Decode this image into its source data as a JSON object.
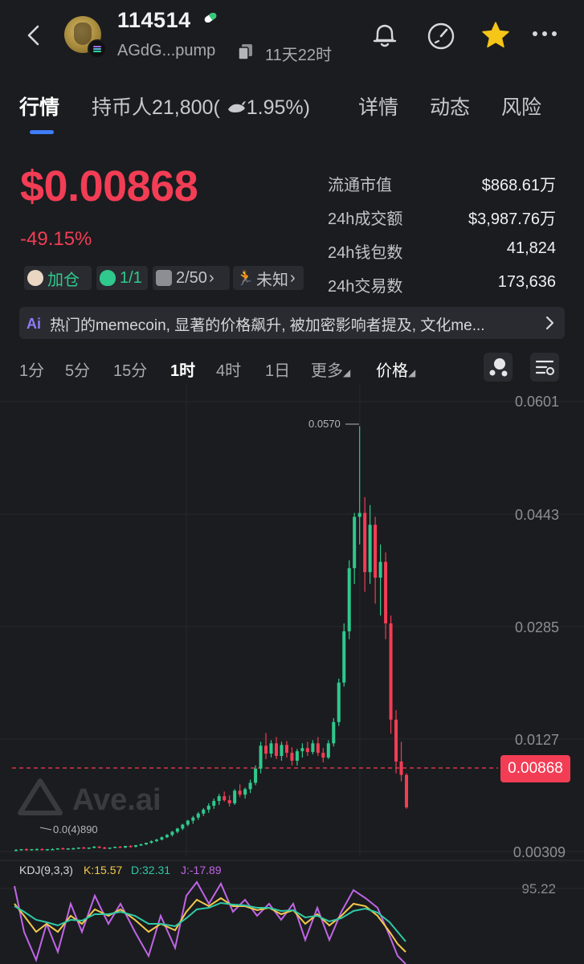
{
  "header": {
    "token_name": "114514",
    "address": "AGdG...pump",
    "age": "11天22时"
  },
  "tabs": [
    {
      "label": "行情",
      "active": true
    },
    {
      "label": "持币人21,800(",
      "active": false
    },
    {
      "label": "1.95%)",
      "active": false
    },
    {
      "label": "详情",
      "active": false
    },
    {
      "label": "动态",
      "active": false
    },
    {
      "label": "风险",
      "active": false
    }
  ],
  "price": {
    "value": "$0.00868",
    "change": "-49.15%"
  },
  "stats": [
    {
      "label": "流通市值",
      "value": "$868.61万"
    },
    {
      "label": "24h成交额",
      "value": "$3,987.76万"
    },
    {
      "label": "24h钱包数",
      "value": "41,824"
    },
    {
      "label": "24h交易数",
      "value": "173,636"
    }
  ],
  "tags": [
    {
      "label": "加仓",
      "icon": "chef-icon"
    },
    {
      "label": "1/1",
      "icon": "money-bag-icon"
    },
    {
      "label": "2/50",
      "icon": "top-crown-icon"
    },
    {
      "label": "未知",
      "icon": "runner-icon"
    }
  ],
  "ai_summary": {
    "icon_label": "Ai",
    "text": "热门的memecoin, 显著的价格飙升, 被加密影响者提及, 文化me..."
  },
  "timeframes": [
    {
      "label": "1分",
      "active": false
    },
    {
      "label": "5分",
      "active": false
    },
    {
      "label": "15分",
      "active": false
    },
    {
      "label": "1时",
      "active": true
    },
    {
      "label": "4时",
      "active": false
    },
    {
      "label": "1日",
      "active": false
    },
    {
      "label": "更多",
      "active": false
    },
    {
      "label": "价格",
      "active": false
    }
  ],
  "colors": {
    "up": "#2fc98d",
    "down": "#f23d55",
    "accent": "#3f7cf5",
    "k_line": "#f2c94c",
    "d_line": "#2fc9a8",
    "j_line": "#c065e8"
  },
  "chart": {
    "y_ticks": [
      "0.0601",
      "0.0443",
      "0.0285",
      "0.0127",
      "0.00309"
    ],
    "current_price_label": "0.00868",
    "high_label": "0.0570",
    "low_label": "0.0(4)890",
    "watermark": "Ave.ai",
    "kdj": {
      "title": "KDJ(9,3,3)",
      "k": "K:15.57",
      "d": "D:32.31",
      "j": "J:-17.89",
      "axis_label": "95.22"
    }
  },
  "chart_data": {
    "type": "candlestick",
    "y_axis": [
      0.00309,
      0.0601
    ],
    "current_price": 0.00868,
    "candles": [
      [
        0.0033,
        0.0034,
        0.0032,
        0.0033
      ],
      [
        0.0033,
        0.0034,
        0.0032,
        0.0034
      ],
      [
        0.0034,
        0.0035,
        0.0032,
        0.0033
      ],
      [
        0.0033,
        0.0034,
        0.0032,
        0.0034
      ],
      [
        0.0034,
        0.0035,
        0.0033,
        0.0034
      ],
      [
        0.0034,
        0.0035,
        0.0033,
        0.0033
      ],
      [
        0.0033,
        0.0034,
        0.0032,
        0.0034
      ],
      [
        0.0034,
        0.0035,
        0.0033,
        0.0034
      ],
      [
        0.0034,
        0.0035,
        0.0033,
        0.0035
      ],
      [
        0.0035,
        0.0036,
        0.0034,
        0.0034
      ],
      [
        0.0034,
        0.0035,
        0.0033,
        0.0035
      ],
      [
        0.0035,
        0.0036,
        0.0034,
        0.0035
      ],
      [
        0.0035,
        0.0036,
        0.0034,
        0.0036
      ],
      [
        0.0036,
        0.0037,
        0.0035,
        0.0035
      ],
      [
        0.0035,
        0.0036,
        0.0034,
        0.0036
      ],
      [
        0.0036,
        0.0038,
        0.0035,
        0.0037
      ],
      [
        0.0037,
        0.0038,
        0.0035,
        0.0036
      ],
      [
        0.0036,
        0.0037,
        0.0034,
        0.0035
      ],
      [
        0.0035,
        0.0036,
        0.0034,
        0.0036
      ],
      [
        0.0036,
        0.0037,
        0.0035,
        0.0037
      ],
      [
        0.0037,
        0.0038,
        0.0036,
        0.0036
      ],
      [
        0.0036,
        0.0038,
        0.0035,
        0.0038
      ],
      [
        0.0038,
        0.0039,
        0.0036,
        0.0037
      ],
      [
        0.0037,
        0.0039,
        0.0036,
        0.0039
      ],
      [
        0.0039,
        0.0041,
        0.0038,
        0.004
      ],
      [
        0.004,
        0.0042,
        0.0039,
        0.0042
      ],
      [
        0.0042,
        0.0045,
        0.0041,
        0.0044
      ],
      [
        0.0044,
        0.0047,
        0.0043,
        0.0046
      ],
      [
        0.0046,
        0.005,
        0.0045,
        0.0049
      ],
      [
        0.0049,
        0.0053,
        0.0048,
        0.0052
      ],
      [
        0.0052,
        0.0057,
        0.005,
        0.0056
      ],
      [
        0.0056,
        0.0061,
        0.0054,
        0.006
      ],
      [
        0.006,
        0.0066,
        0.0058,
        0.0065
      ],
      [
        0.0065,
        0.0071,
        0.0063,
        0.007
      ],
      [
        0.007,
        0.0076,
        0.0066,
        0.0074
      ],
      [
        0.0074,
        0.0081,
        0.0071,
        0.0079
      ],
      [
        0.0079,
        0.0086,
        0.0076,
        0.0084
      ],
      [
        0.0084,
        0.0092,
        0.008,
        0.0089
      ],
      [
        0.0089,
        0.0098,
        0.0085,
        0.0095
      ],
      [
        0.0095,
        0.0104,
        0.009,
        0.0101
      ],
      [
        0.0101,
        0.0107,
        0.0094,
        0.0096
      ],
      [
        0.0096,
        0.0102,
        0.0088,
        0.0092
      ],
      [
        0.0092,
        0.011,
        0.009,
        0.0108
      ],
      [
        0.0108,
        0.0116,
        0.01,
        0.0103
      ],
      [
        0.0103,
        0.0112,
        0.0098,
        0.011
      ],
      [
        0.011,
        0.0122,
        0.0105,
        0.0118
      ],
      [
        0.0118,
        0.014,
        0.0115,
        0.0136
      ],
      [
        0.0136,
        0.017,
        0.013,
        0.0165
      ],
      [
        0.0165,
        0.0181,
        0.0148,
        0.0155
      ],
      [
        0.0155,
        0.0172,
        0.015,
        0.0168
      ],
      [
        0.0168,
        0.0176,
        0.0148,
        0.0152
      ],
      [
        0.0152,
        0.017,
        0.0146,
        0.0166
      ],
      [
        0.0166,
        0.0171,
        0.015,
        0.0156
      ],
      [
        0.0156,
        0.0163,
        0.014,
        0.0146
      ],
      [
        0.0146,
        0.0161,
        0.014,
        0.0158
      ],
      [
        0.0158,
        0.0168,
        0.015,
        0.0162
      ],
      [
        0.0162,
        0.017,
        0.0152,
        0.0157
      ],
      [
        0.0157,
        0.0172,
        0.0154,
        0.0168
      ],
      [
        0.0168,
        0.0176,
        0.0152,
        0.0156
      ],
      [
        0.0156,
        0.0162,
        0.0144,
        0.015
      ],
      [
        0.015,
        0.0172,
        0.0148,
        0.0168
      ],
      [
        0.0168,
        0.02,
        0.0164,
        0.0195
      ],
      [
        0.0195,
        0.025,
        0.019,
        0.0245
      ],
      [
        0.0245,
        0.032,
        0.024,
        0.031
      ],
      [
        0.031,
        0.04,
        0.03,
        0.039
      ],
      [
        0.039,
        0.046,
        0.037,
        0.0455
      ],
      [
        0.0455,
        0.057,
        0.042,
        0.046
      ],
      [
        0.046,
        0.048,
        0.036,
        0.0385
      ],
      [
        0.0385,
        0.047,
        0.037,
        0.0445
      ],
      [
        0.0445,
        0.0455,
        0.0345,
        0.0378
      ],
      [
        0.0378,
        0.042,
        0.033,
        0.0398
      ],
      [
        0.0398,
        0.041,
        0.03,
        0.032
      ],
      [
        0.032,
        0.033,
        0.018,
        0.0198
      ],
      [
        0.0198,
        0.021,
        0.013,
        0.0145
      ],
      [
        0.0145,
        0.017,
        0.012,
        0.0128
      ],
      [
        0.0128,
        0.013,
        0.0085,
        0.00868
      ]
    ]
  }
}
